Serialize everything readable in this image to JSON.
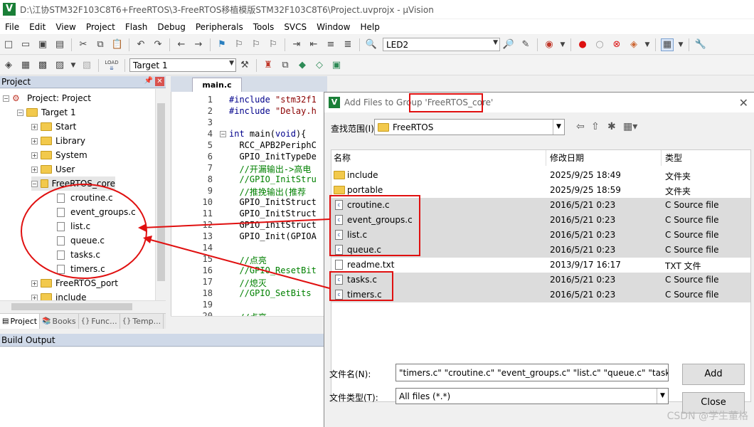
{
  "window": {
    "title": "D:\\江协STM32F103C8T6+FreeRTOS\\3-FreeRTOS移植模版STM32F103C8T6\\Project.uvprojx - µVision",
    "logo": "V"
  },
  "menu": [
    "File",
    "Edit",
    "View",
    "Project",
    "Flash",
    "Debug",
    "Peripherals",
    "Tools",
    "SVCS",
    "Window",
    "Help"
  ],
  "toolbar": {
    "search_combo": "LED2",
    "target_combo": "Target 1",
    "load_label": "LOAD"
  },
  "project_panel": {
    "title": "Project",
    "root": "Project: Project",
    "target": "Target 1",
    "groups": [
      "Start",
      "Library",
      "System",
      "User"
    ],
    "freertos_core": {
      "name": "FreeRTOS_core",
      "files": [
        "croutine.c",
        "event_groups.c",
        "list.c",
        "queue.c",
        "tasks.c",
        "timers.c"
      ]
    },
    "after_groups": [
      "FreeRTOS_port",
      "include"
    ],
    "tabs": [
      "Project",
      "Books",
      "Func...",
      "Temp..."
    ]
  },
  "editor": {
    "tab": "main.c",
    "lines": [
      {
        "n": "1",
        "parts": [
          {
            "t": "#include ",
            "c": "kw"
          },
          {
            "t": "\"stm32f1",
            "c": "str"
          }
        ]
      },
      {
        "n": "2",
        "parts": [
          {
            "t": "#include ",
            "c": "kw"
          },
          {
            "t": "\"Delay.h",
            "c": "str"
          }
        ]
      },
      {
        "n": "3",
        "parts": []
      },
      {
        "n": "4",
        "parts": [
          {
            "t": "int ",
            "c": "kw"
          },
          {
            "t": "main(",
            "c": ""
          },
          {
            "t": "void",
            "c": "kw"
          },
          {
            "t": "){",
            "c": ""
          }
        ]
      },
      {
        "n": "5",
        "parts": [
          {
            "t": "  RCC_APB2PeriphC",
            "c": ""
          }
        ]
      },
      {
        "n": "6",
        "parts": [
          {
            "t": "  GPIO_InitTypeDe",
            "c": ""
          }
        ]
      },
      {
        "n": "7",
        "parts": [
          {
            "t": "  //开漏输出->高电",
            "c": "cmt"
          }
        ]
      },
      {
        "n": "8",
        "parts": [
          {
            "t": "  //GPIO_InitStru",
            "c": "cmt"
          }
        ]
      },
      {
        "n": "9",
        "parts": [
          {
            "t": "  //推挽输出(推荐",
            "c": "cmt"
          }
        ]
      },
      {
        "n": "10",
        "parts": [
          {
            "t": "  GPIO_InitStruct",
            "c": ""
          }
        ]
      },
      {
        "n": "11",
        "parts": [
          {
            "t": "  GPIO_InitStruct",
            "c": ""
          }
        ]
      },
      {
        "n": "12",
        "parts": [
          {
            "t": "  GPIO_InitStruct",
            "c": ""
          }
        ]
      },
      {
        "n": "13",
        "parts": [
          {
            "t": "  GPIO_Init(GPIOA",
            "c": ""
          }
        ]
      },
      {
        "n": "14",
        "parts": []
      },
      {
        "n": "15",
        "parts": [
          {
            "t": "  //点亮",
            "c": "cmt"
          }
        ]
      },
      {
        "n": "16",
        "parts": [
          {
            "t": "  //GPIO_ResetBit",
            "c": "cmt"
          }
        ]
      },
      {
        "n": "17",
        "parts": [
          {
            "t": "  //熄灭",
            "c": "cmt"
          }
        ]
      },
      {
        "n": "18",
        "parts": [
          {
            "t": "  //GPIO_SetBits",
            "c": "cmt"
          }
        ]
      },
      {
        "n": "19",
        "parts": []
      },
      {
        "n": "20",
        "parts": [
          {
            "t": "  //点亮",
            "c": "cmt"
          }
        ]
      }
    ]
  },
  "build_output": {
    "title": "Build Output"
  },
  "dialog": {
    "title": "Add Files to Group 'FreeRTOS_core'",
    "look_in_label": "查找范围(I):",
    "look_in_value": "FreeRTOS",
    "columns": [
      "名称",
      "修改日期",
      "类型"
    ],
    "files": [
      {
        "name": "include",
        "date": "2025/9/25 18:49",
        "type": "文件夹",
        "kind": "folder",
        "highlight": false
      },
      {
        "name": "portable",
        "date": "2025/9/25 18:59",
        "type": "文件夹",
        "kind": "folder",
        "highlight": false
      },
      {
        "name": "croutine.c",
        "date": "2016/5/21 0:23",
        "type": "C Source file",
        "kind": "c",
        "highlight": true
      },
      {
        "name": "event_groups.c",
        "date": "2016/5/21 0:23",
        "type": "C Source file",
        "kind": "c",
        "highlight": true
      },
      {
        "name": "list.c",
        "date": "2016/5/21 0:23",
        "type": "C Source file",
        "kind": "c",
        "highlight": true
      },
      {
        "name": "queue.c",
        "date": "2016/5/21 0:23",
        "type": "C Source file",
        "kind": "c",
        "highlight": true
      },
      {
        "name": "readme.txt",
        "date": "2013/9/17 16:17",
        "type": "TXT 文件",
        "kind": "txt",
        "highlight": false
      },
      {
        "name": "tasks.c",
        "date": "2016/5/21 0:23",
        "type": "C Source file",
        "kind": "c",
        "highlight": true
      },
      {
        "name": "timers.c",
        "date": "2016/5/21 0:23",
        "type": "C Source file",
        "kind": "c",
        "highlight": true
      }
    ],
    "filename_label": "文件名(N):",
    "filename_value": "\"timers.c\" \"croutine.c\" \"event_groups.c\" \"list.c\" \"queue.c\" \"tasks.c\"",
    "filetype_label": "文件类型(T):",
    "filetype_value": "All files (*.*)",
    "add_label": "Add",
    "close_label": "Close"
  },
  "watermark": "CSDN @学生董格",
  "colors": {
    "annotation": "#e01010",
    "highlight_row": "#dcdcdc",
    "panel_header": "#cfd9e8"
  }
}
